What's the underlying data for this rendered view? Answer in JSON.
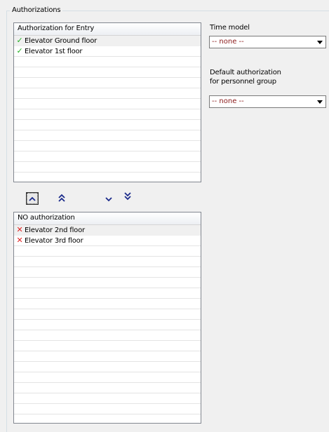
{
  "group": {
    "title": "Authorizations"
  },
  "authorized_list": {
    "header": "Authorization for Entry",
    "items": [
      {
        "label": "Elevator Ground floor",
        "icon": "check-icon"
      },
      {
        "label": "Elevator 1st floor",
        "icon": "check-icon"
      }
    ]
  },
  "unauthorized_list": {
    "header": "NO authorization",
    "items": [
      {
        "label": "Elevator 2nd floor",
        "icon": "x-icon"
      },
      {
        "label": "Elevator 3rd floor",
        "icon": "x-icon"
      }
    ]
  },
  "time_model": {
    "label": "Time model",
    "value": "-- none --"
  },
  "default_authorization": {
    "label_line1": "Default authorization",
    "label_line2": "for personnel group",
    "value": "-- none --"
  },
  "move_buttons": [
    "move-top",
    "move-up",
    "move-down",
    "move-bottom"
  ],
  "colors": {
    "check": "#22b022",
    "cross": "#e02020",
    "combo_text": "#8b1a1a",
    "arrow": "#1a2a8a"
  }
}
